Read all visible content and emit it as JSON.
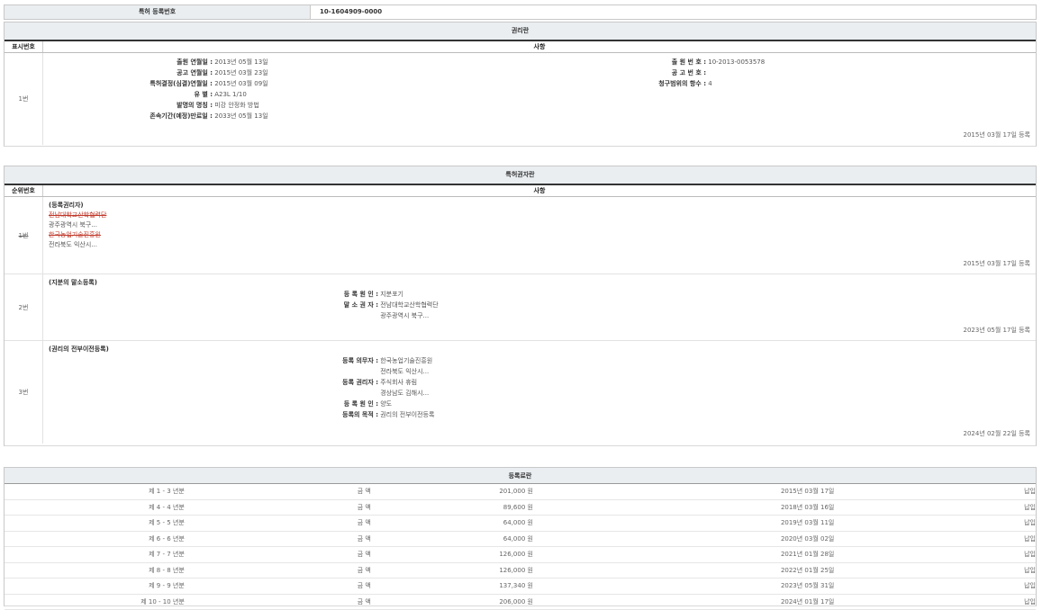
{
  "top": {
    "label": "특허 등록번호",
    "value": "10-1604909-0000"
  },
  "rights": {
    "title": "권리란",
    "col_num": "표시번호",
    "col_detail": "사항",
    "row": {
      "num": "1번",
      "left": [
        {
          "k": "출원 연월일 :",
          "v": "2013년 05월 13일"
        },
        {
          "k": "공고 연월일 :",
          "v": "2015년 03월 23일"
        },
        {
          "k": "특허결정(심결)연월일 :",
          "v": "2015년 03월 09일"
        },
        {
          "k": "유 별 :",
          "v": "A23L 1/10"
        },
        {
          "k": "발명의 명칭 :",
          "v": "미강 안정화 방법"
        },
        {
          "k": "존속기간(예정)만료일 :",
          "v": "2033년 05월 13일"
        }
      ],
      "right": [
        {
          "k": "출 원 번 호 :",
          "v": "10-2013-0053578"
        },
        {
          "k": "공 고 번 호 :",
          "v": ""
        },
        {
          "k": "청구범위의 항수 :",
          "v": "4"
        }
      ],
      "date": "2015년 03월 17일 등록"
    }
  },
  "holders": {
    "title": "특허권자란",
    "col_num": "순위번호",
    "col_detail": "사항",
    "r1": {
      "num": "1번",
      "label": "(등록권리자)",
      "l1": "전남대학교산학협력단",
      "l2": "광주광역시 북구...",
      "l3": "한국농업기술진흥원",
      "l4": "전라북도 익산시...",
      "date": "2015년 03월 17일 등록"
    },
    "r2": {
      "num": "2번",
      "label": "(지분의 말소등록)",
      "k1": "등 록 원 인 :",
      "v1": "지분포기",
      "k2": "말 소 권 자 :",
      "v2": "전남대학교산학협력단",
      "v3": "광주광역시 북구...",
      "date": "2023년 05월 17일 등록"
    },
    "r3": {
      "num": "3번",
      "label": "(권리의 전부이전등록)",
      "k1": "등록 의무자 :",
      "v1": "한국농업기술진흥원",
      "v1b": "전라북도 익산시...",
      "k2": "등록 권리자 :",
      "v2": "주식회사 휴림",
      "v2b": "경상남도 김해시...",
      "k3": "등 록 원 인 :",
      "v3": "양도",
      "k4": "등록의 목적 :",
      "v4": "권리의 전부이전등록",
      "date": "2024년 02월 22일 등록"
    }
  },
  "fees": {
    "title": "등록료란",
    "rows": [
      {
        "period": "제 1 - 3 년분",
        "label": "금 액",
        "amount": "201,000 원",
        "date": "2015년 03월 17일",
        "status": "납입"
      },
      {
        "period": "제 4 - 4 년분",
        "label": "금 액",
        "amount": "89,600 원",
        "date": "2018년 03월 16일",
        "status": "납입"
      },
      {
        "period": "제 5 - 5 년분",
        "label": "금 액",
        "amount": "64,000 원",
        "date": "2019년 03월 11일",
        "status": "납입"
      },
      {
        "period": "제 6 - 6 년분",
        "label": "금 액",
        "amount": "64,000 원",
        "date": "2020년 03월 02일",
        "status": "납입"
      },
      {
        "period": "제 7 - 7 년분",
        "label": "금 액",
        "amount": "126,000 원",
        "date": "2021년 01월 28일",
        "status": "납입"
      },
      {
        "period": "제 8 - 8 년분",
        "label": "금 액",
        "amount": "126,000 원",
        "date": "2022년 01월 25일",
        "status": "납입"
      },
      {
        "period": "제 9 - 9 년분",
        "label": "금 액",
        "amount": "137,340 원",
        "date": "2023년 05월 31일",
        "status": "납입"
      },
      {
        "period": "제 10 - 10 년분",
        "label": "금 액",
        "amount": "206,000 원",
        "date": "2024년 01월 17일",
        "status": "납입"
      }
    ]
  }
}
